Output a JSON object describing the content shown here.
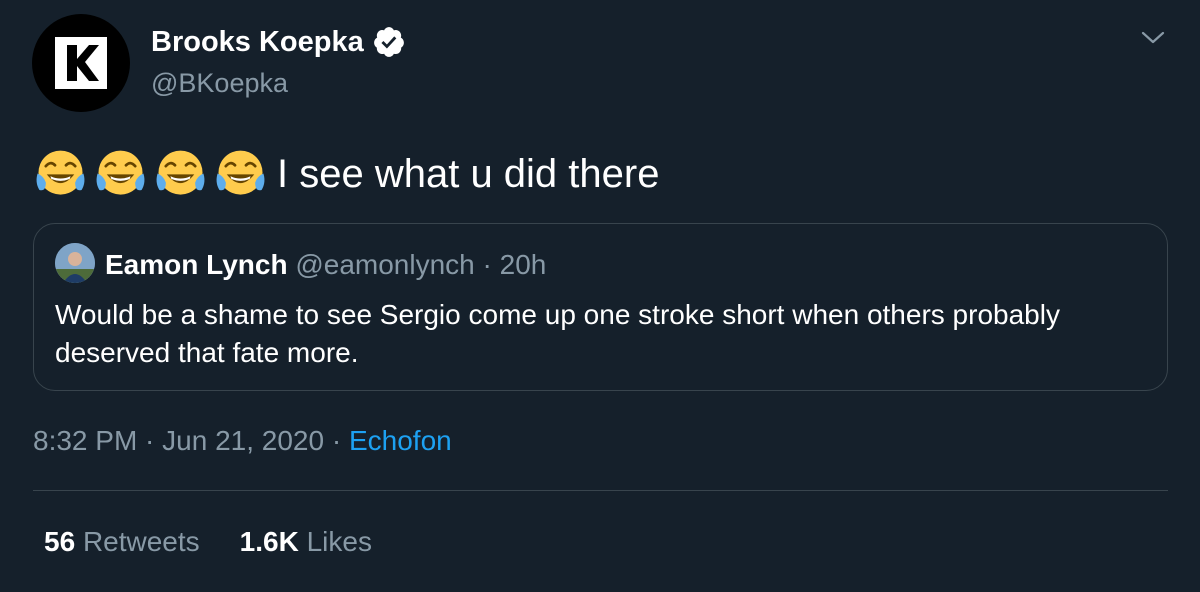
{
  "tweet": {
    "author_name": "Brooks Koepka",
    "author_handle": "@BKoepka",
    "text": "I see what u did there",
    "emoji_count": 4,
    "emoji_name": "face-with-tears-of-joy",
    "timestamp": "8:32 PM · Jun 21, 2020",
    "source_separator": " · ",
    "source": "Echofon"
  },
  "quote": {
    "author_name": "Eamon Lynch",
    "author_handle": "@eamonlynch",
    "separator": " · ",
    "age": "20h",
    "text": "Would be a shame to see Sergio come up one stroke short when others probably deserved that fate more."
  },
  "stats": {
    "retweets_count": "56",
    "retweets_label": "Retweets",
    "likes_count": "1.6K",
    "likes_label": "Likes"
  },
  "colors": {
    "background": "#15202b",
    "secondary_text": "#8899a6",
    "link": "#1da1f2",
    "border": "#38444d"
  },
  "icons": {
    "avatar": "brand-k-logo",
    "verified": "verified-badge-icon",
    "menu": "chevron-down-icon"
  }
}
